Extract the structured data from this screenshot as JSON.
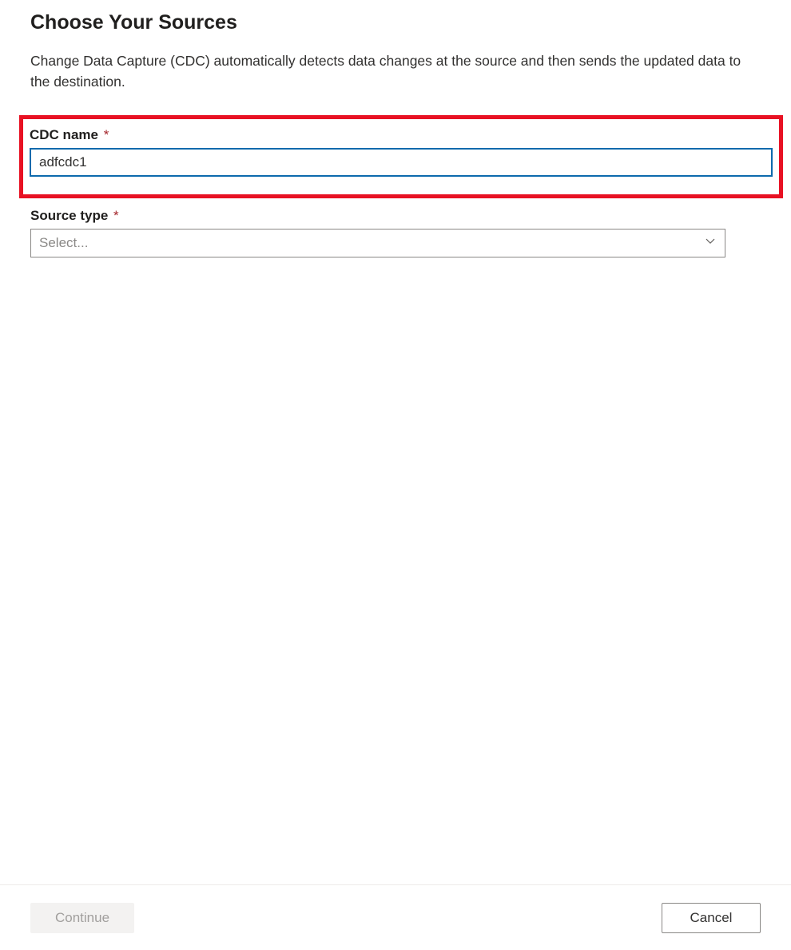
{
  "page": {
    "title": "Choose Your Sources",
    "description": "Change Data Capture (CDC) automatically detects data changes at the source and then sends the updated data to the destination."
  },
  "form": {
    "cdc_name": {
      "label": "CDC name",
      "required_marker": "*",
      "value": "adfcdc1"
    },
    "source_type": {
      "label": "Source type",
      "required_marker": "*",
      "placeholder": "Select..."
    }
  },
  "footer": {
    "continue_label": "Continue",
    "cancel_label": "Cancel"
  }
}
